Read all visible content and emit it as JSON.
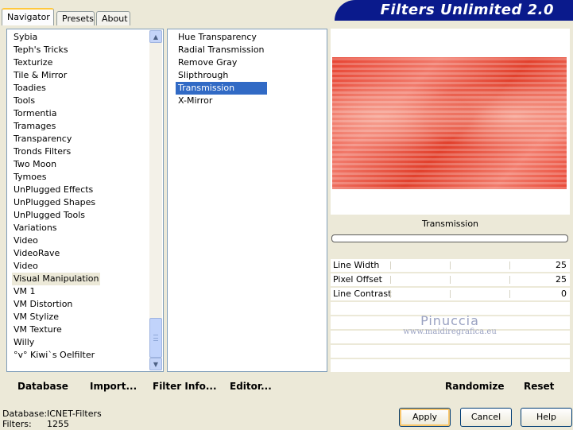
{
  "tabs": [
    {
      "label": "Navigator",
      "active": true
    },
    {
      "label": "Presets",
      "active": false
    },
    {
      "label": "About",
      "active": false
    }
  ],
  "banner_title": "Filters Unlimited 2.0",
  "categories": [
    "Sybia",
    "Teph's Tricks",
    "Texturize",
    "Tile & Mirror",
    "Toadies",
    "Tools",
    "Tormentia",
    "Tramages",
    "Transparency",
    "Tronds Filters",
    "Two Moon",
    "Tymoes",
    "UnPlugged Effects",
    "UnPlugged Shapes",
    "UnPlugged Tools",
    "Variations",
    "Video",
    "VideoRave",
    "Video",
    "Visual Manipulation",
    "VM 1",
    "VM Distortion",
    "VM Stylize",
    "VM Texture",
    "Willy",
    "°v° Kiwi`s Oelfilter"
  ],
  "selected_category": "Visual Manipulation",
  "filters": [
    "Hue Transparency",
    "Radial Transmission",
    "Remove Gray",
    "Slipthrough",
    "Transmission",
    "X-Mirror"
  ],
  "selected_filter": "Transmission",
  "preview": {
    "filter_name": "Transmission",
    "progress": 0
  },
  "params": [
    {
      "label": "Line Width",
      "value": "25"
    },
    {
      "label": "Pixel Offset",
      "value": "25"
    },
    {
      "label": "Line Contrast",
      "value": "0"
    }
  ],
  "watermark": {
    "line1": "Pinuccia",
    "line2": "www.maidiregrafica.eu"
  },
  "toolbar": {
    "database": "Database",
    "import": "Import...",
    "filter_info": "Filter Info...",
    "editor": "Editor...",
    "randomize": "Randomize",
    "reset": "Reset"
  },
  "status": {
    "database_label": "Database:",
    "database_value": "ICNET-Filters",
    "filters_label": "Filters:",
    "filters_value": "1255"
  },
  "buttons": {
    "apply": "Apply",
    "cancel": "Cancel",
    "help": "Help"
  },
  "colors": {
    "selection": "#316ac5",
    "banner": "#0a1a8c",
    "background": "#ece9d8"
  }
}
